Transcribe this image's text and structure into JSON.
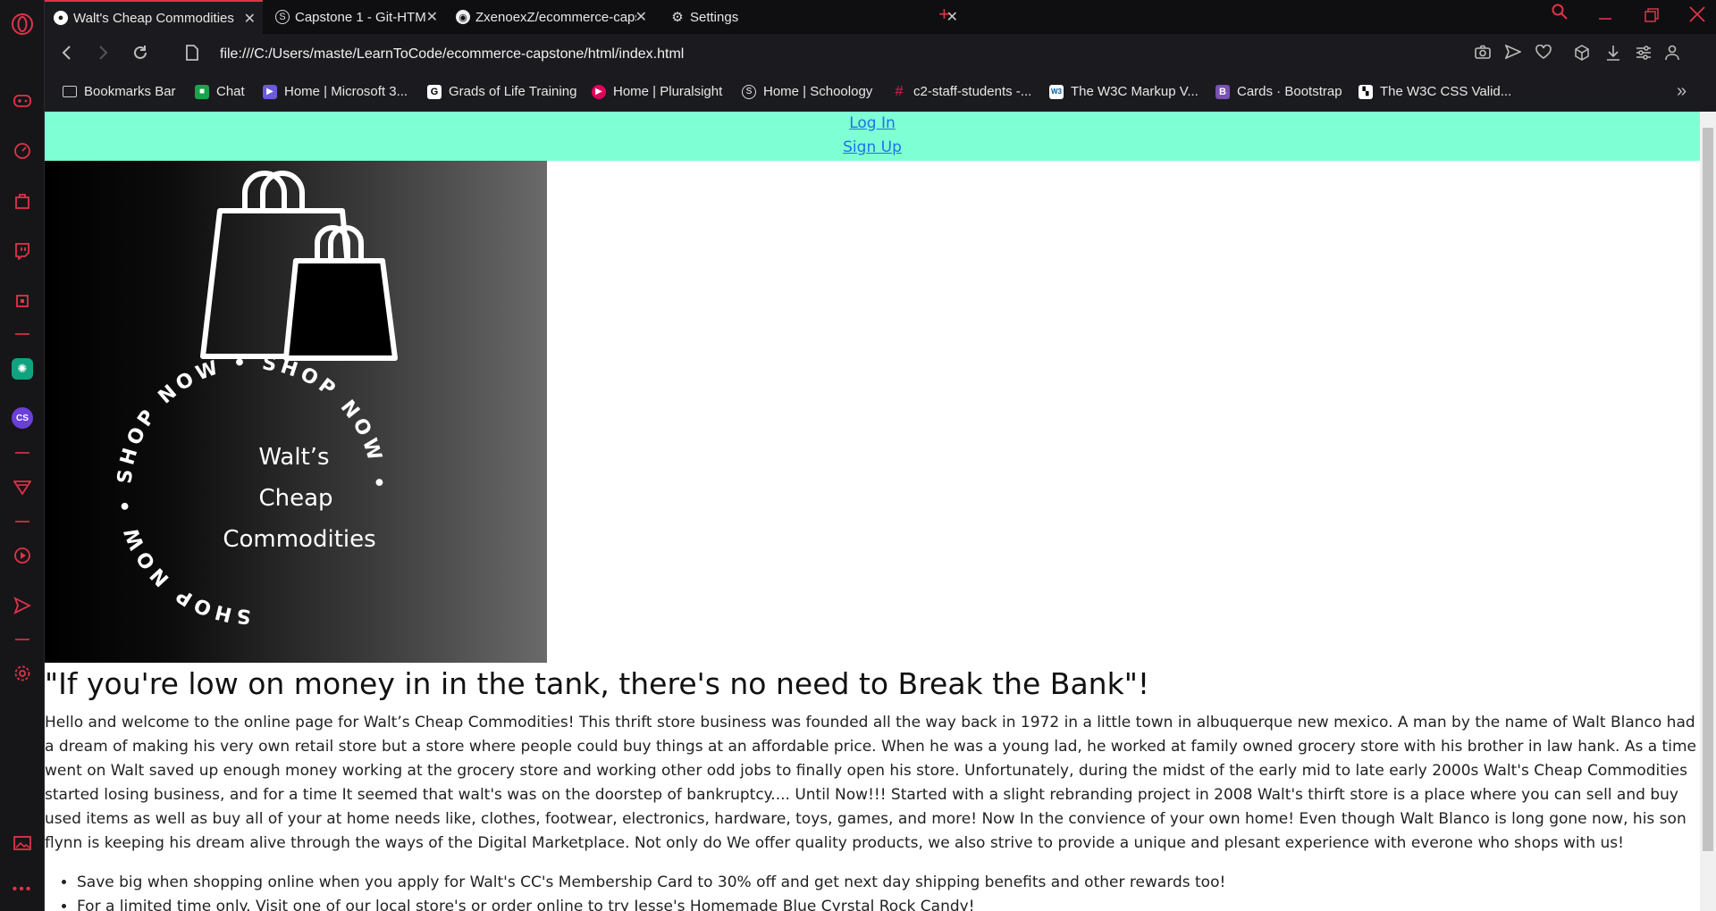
{
  "tabs": [
    {
      "title": "Walt's Cheap Commodities",
      "icon": "globe-icon"
    },
    {
      "title": "Capstone 1 - Git-HTML-CSS",
      "icon": "schoology-icon"
    },
    {
      "title": "ZxenoexZ/ecommerce-capstone",
      "icon": "github-icon"
    },
    {
      "title": "Settings",
      "icon": "gear-icon"
    }
  ],
  "address": {
    "url": "file:///C:/Users/maste/LearnToCode/ecommerce-capstone/html/index.html"
  },
  "bookmarks": [
    {
      "label": "Bookmarks Bar",
      "icon": "folder-icon",
      "color": "#5a5a5a"
    },
    {
      "label": "Chat",
      "icon": "chat-icon",
      "color": "#1aa34a"
    },
    {
      "label": "Home | Microsoft 3...",
      "icon": "microsoft-icon",
      "color": "#6b5bdc"
    },
    {
      "label": "Grads of Life Training",
      "icon": "g-icon",
      "color": "#ffffff"
    },
    {
      "label": "Home | Pluralsight",
      "icon": "pluralsight-icon",
      "color": "#e5005a"
    },
    {
      "label": "Home | Schoology",
      "icon": "schoology-icon",
      "color": "#2c7fb8"
    },
    {
      "label": "c2-staff-students -...",
      "icon": "slack-icon",
      "color": "#e01e5a"
    },
    {
      "label": "The W3C Markup V...",
      "icon": "w3c-icon",
      "color": "#ffffff"
    },
    {
      "label": "Cards · Bootstrap",
      "icon": "bootstrap-icon",
      "color": "#7952b3"
    },
    {
      "label": "The W3C CSS Valid...",
      "icon": "w3c-css-icon",
      "color": "#ffffff"
    }
  ],
  "page": {
    "nav": {
      "login": "Log In",
      "signup": "Sign Up"
    },
    "logo": {
      "ring_text": "SHOP NOW • SHOP NOW • SHOP NOW •",
      "line1": "Walt’s",
      "line2": "Cheap",
      "line3": "Commodities"
    },
    "headline": "\"If you're low on money in in the tank, there's no need to Break the Bank\"!",
    "intro": "Hello and welcome to the online page for Walt’s Cheap Commodities! This thrift store business was founded all the way back in 1972 in a little town in albuquerque new mexico. A man by the name of Walt Blanco had a dream of making his very own retail store but a store where people could buy things at an affordable price. When he was a young lad, he worked at family owned grocery store with his brother in law hank. As a time went on Walt saved up enough money working at the grocery store and working other odd jobs to finally open his store. Unfortunately, during the midst of the early mid to late early 2000s Walt's Cheap Commodities started losing business, and for a time It seemed that walt's was on the doorstep of bankruptcy.... Until Now!!! Started with a slight rebranding project in 2008 Walt's thirft store is a place where you can sell and buy used items as well as buy all of your at home needs like, clothes, footwear, electronics, hardware, toys, games, and more! Now In the convience of your own home! Even though Walt Blanco is long gone now, his son flynn is keeping his dream alive through the ways of the Digital Marketplace. Not only do We offer quality products, we also strive to provide a unique and plesant experience with everone who shops with us!",
    "perks": [
      "Save big when shopping online when you apply for Walt's CC's Membership Card to 30% off and get next day shipping benefits and other rewards too!",
      "For a limited time only. Visit one of our local store's or order online to try Jesse's Homemade Blue Cyrstal Rock Candy!"
    ]
  }
}
